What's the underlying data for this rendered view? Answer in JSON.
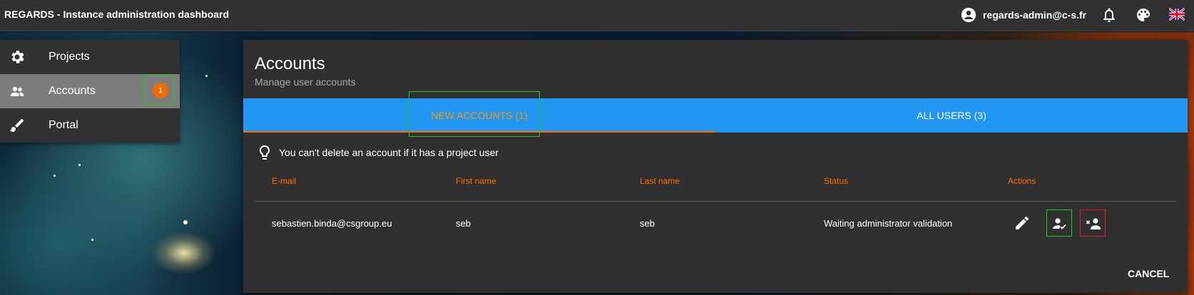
{
  "appbar": {
    "title": "REGARDS - Instance administration dashboard",
    "user": "regards-admin@c-s.fr",
    "icons": [
      "account-circle-icon",
      "bell-icon",
      "palette-icon",
      "uk-flag-icon"
    ]
  },
  "sidemenu": {
    "items": [
      {
        "label": "Projects",
        "icon": "gear-icon"
      },
      {
        "label": "Accounts",
        "icon": "people-icon",
        "badge": "1",
        "active": true
      },
      {
        "label": "Portal",
        "icon": "brush-icon"
      }
    ]
  },
  "card": {
    "title": "Accounts",
    "subtitle": "Manage user accounts",
    "tabs": [
      {
        "label": "NEW ACCOUNTS (1)",
        "selected": true
      },
      {
        "label": "ALL USERS (3)",
        "selected": false
      }
    ],
    "tip": "You can't delete an account if it has a project user",
    "table": {
      "headers": [
        "E-mail",
        "First name",
        "Last name",
        "Status",
        "Actions"
      ],
      "rows": [
        {
          "email": "sebastien.binda@csgroup.eu",
          "first_name": "seb",
          "last_name": "seb",
          "status": "Waiting administrator validation",
          "actions": [
            "edit-icon",
            "accept-user-icon",
            "refuse-user-icon"
          ]
        }
      ]
    },
    "cancel_label": "CANCEL"
  },
  "colors": {
    "accent": "#ff6d00",
    "tab_bar": "#2196f3",
    "appbar": "#313131",
    "card": "#303030"
  }
}
